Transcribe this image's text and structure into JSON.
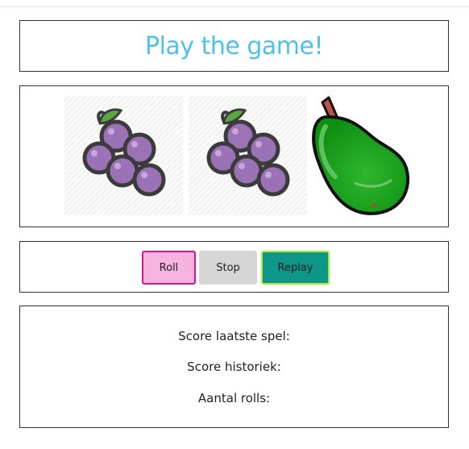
{
  "title": "Play the game!",
  "colors": {
    "title": "#4fc0ec",
    "roll_bg": "#f7b3e0",
    "roll_border": "#d6168a",
    "stop_bg": "#d6d6d6",
    "replay_bg": "#0e9689",
    "replay_border": "#a4ef34"
  },
  "reels": [
    {
      "symbol": "grapes-icon"
    },
    {
      "symbol": "grapes-icon"
    },
    {
      "symbol": "pear-icon"
    }
  ],
  "controls": {
    "roll_label": "Roll",
    "stop_label": "Stop",
    "replay_label": "Replay"
  },
  "scores": {
    "last_game_label": "Score laatste spel:",
    "history_label": "Score historiek:",
    "rolls_label": "Aantal rolls:"
  }
}
